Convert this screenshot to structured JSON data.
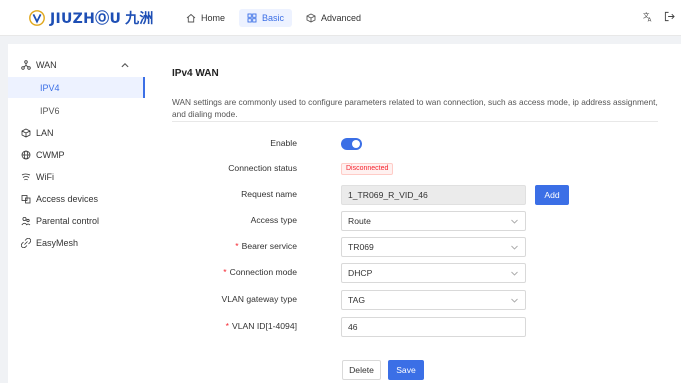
{
  "header": {
    "brand": "JIUZHⓄU",
    "brand_cn": "九洲",
    "nav": [
      {
        "label": "Home",
        "icon": "home-icon"
      },
      {
        "label": "Basic",
        "icon": "grid-icon",
        "active": true
      },
      {
        "label": "Advanced",
        "icon": "cube-icon"
      }
    ],
    "right_icons": [
      "translate-icon",
      "logout-icon"
    ]
  },
  "sidebar": {
    "items": [
      {
        "label": "WAN",
        "icon": "network-icon",
        "expanded": true
      },
      {
        "label": "IPV4",
        "active": true
      },
      {
        "label": "IPV6"
      },
      {
        "label": "LAN",
        "icon": "lan-icon"
      },
      {
        "label": "CWMP",
        "icon": "globe-icon"
      },
      {
        "label": "WiFi",
        "icon": "wifi-icon"
      },
      {
        "label": "Access devices",
        "icon": "devices-icon"
      },
      {
        "label": "Parental control",
        "icon": "parental-icon"
      },
      {
        "label": "EasyMesh",
        "icon": "mesh-icon"
      }
    ]
  },
  "main": {
    "title": "IPv4 WAN",
    "description": "WAN settings are commonly used to configure parameters related to wan connection, such as access mode, ip address assignment, and dialing mode.",
    "form": {
      "enable_label": "Enable",
      "enable_value": true,
      "status_label": "Connection status",
      "status_value": "Disconnected",
      "request_label": "Request name",
      "request_value": "1_TR069_R_VID_46",
      "add_label": "Add",
      "access_type_label": "Access type",
      "access_type_value": "Route",
      "bearer_label": "Bearer service",
      "bearer_value": "TR069",
      "conn_mode_label": "Connection mode",
      "conn_mode_value": "DHCP",
      "vlan_gw_label": "VLAN gateway type",
      "vlan_gw_value": "TAG",
      "vlan_id_label": "VLAN ID[1-4094]",
      "vlan_id_value": "46",
      "required_mark": "*",
      "delete_label": "Delete",
      "save_label": "Save"
    }
  },
  "colors": {
    "accent": "#3b6fe6",
    "brand": "#1e4fb5",
    "error": "#f5222d"
  }
}
